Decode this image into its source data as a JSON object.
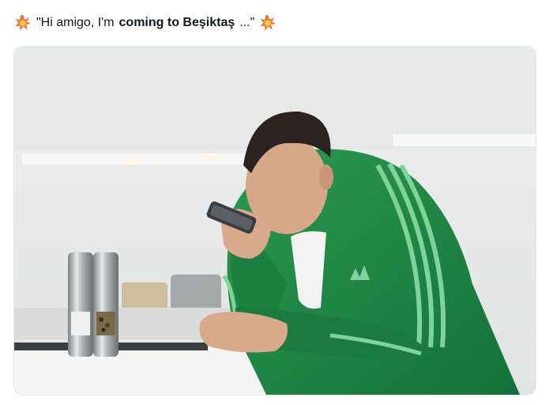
{
  "tweet": {
    "caption": {
      "prefix_emoji": "collision-icon",
      "text_plain": "\"Hi amigo, I'm ",
      "text_bold": "coming to Beşiktaş",
      "text_end": "...\"",
      "suffix_emoji": "collision-icon"
    },
    "media": {
      "type": "photo",
      "colors": {
        "jacket": "#1f8a43",
        "stripes": "#7fd39a",
        "background": "#e9ecea",
        "counter": "#f4f4f4"
      }
    }
  }
}
